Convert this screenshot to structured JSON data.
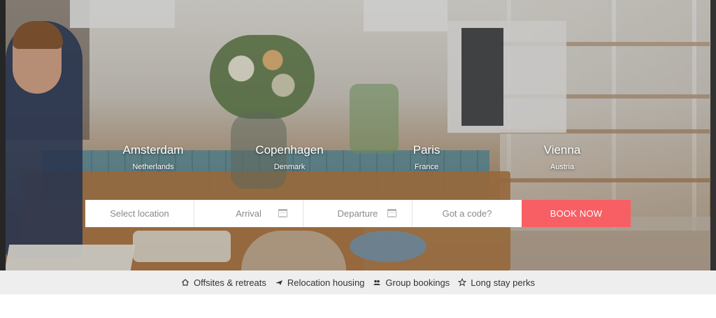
{
  "cities": [
    {
      "name": "Amsterdam",
      "country": "Netherlands"
    },
    {
      "name": "Copenhagen",
      "country": "Denmark"
    },
    {
      "name": "Paris",
      "country": "France"
    },
    {
      "name": "Vienna",
      "country": "Austria"
    }
  ],
  "booking": {
    "location_placeholder": "Select location",
    "arrival_placeholder": "Arrival",
    "departure_placeholder": "Departure",
    "code_placeholder": "Got a code?",
    "book_label": "BOOK NOW",
    "accent_color": "#f85f64"
  },
  "perks": [
    {
      "label": "Offsites & retreats",
      "icon": "house-icon"
    },
    {
      "label": "Relocation housing",
      "icon": "plane-icon"
    },
    {
      "label": "Group bookings",
      "icon": "group-icon"
    },
    {
      "label": "Long stay perks",
      "icon": "star-icon"
    }
  ]
}
